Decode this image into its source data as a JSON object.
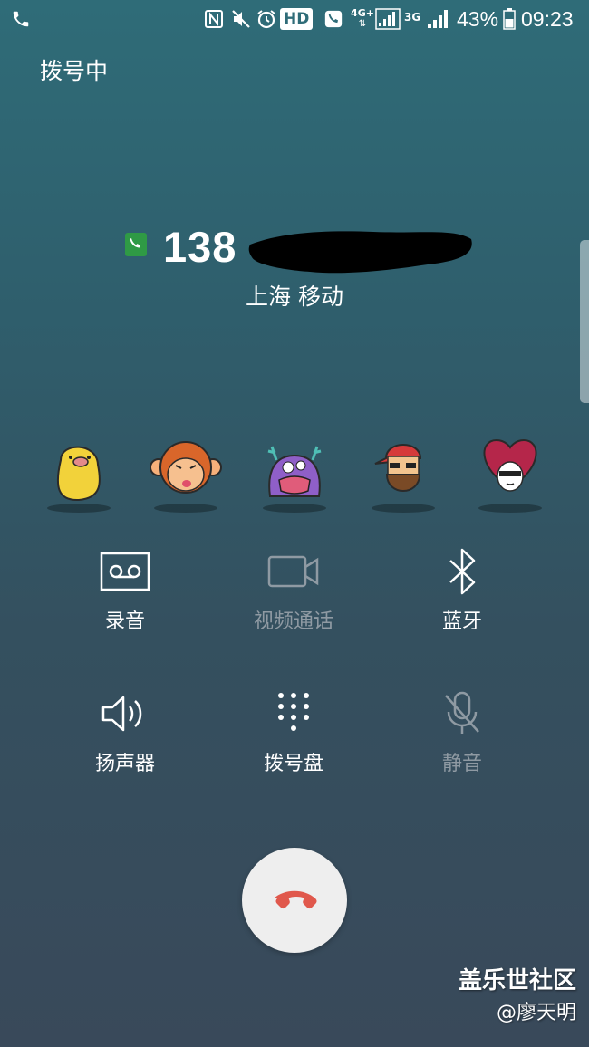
{
  "status_bar": {
    "battery_percent": "43%",
    "time": "09:23",
    "hd_label": "HD",
    "network_4g": "4G+",
    "network_3g": "3G",
    "icons": [
      "phone-icon",
      "nfc-icon",
      "mute-icon",
      "alarm-icon",
      "hd-voice-icon",
      "wifi-call-icon",
      "signal-icon",
      "signal-icon",
      "battery-icon"
    ]
  },
  "call": {
    "status": "拨号中",
    "number": "138",
    "location": "上海 移动"
  },
  "emojis": [
    "potato-emoji",
    "monkey-emoji",
    "monster-emoji",
    "bearded-man-emoji",
    "heart-face-emoji"
  ],
  "controls": {
    "record": {
      "label": "录音",
      "icon": "voicemail-icon"
    },
    "video_call": {
      "label": "视频通话",
      "icon": "video-camera-icon"
    },
    "bluetooth": {
      "label": "蓝牙",
      "icon": "bluetooth-icon"
    },
    "speaker": {
      "label": "扬声器",
      "icon": "speaker-icon"
    },
    "keypad": {
      "label": "拨号盘",
      "icon": "keypad-icon"
    },
    "mute": {
      "label": "静音",
      "icon": "mic-off-icon"
    }
  },
  "end_call": {
    "icon": "end-call-icon",
    "color": "#e0584c"
  },
  "watermark": {
    "community": "盖乐世社区",
    "author": "@廖天明"
  }
}
